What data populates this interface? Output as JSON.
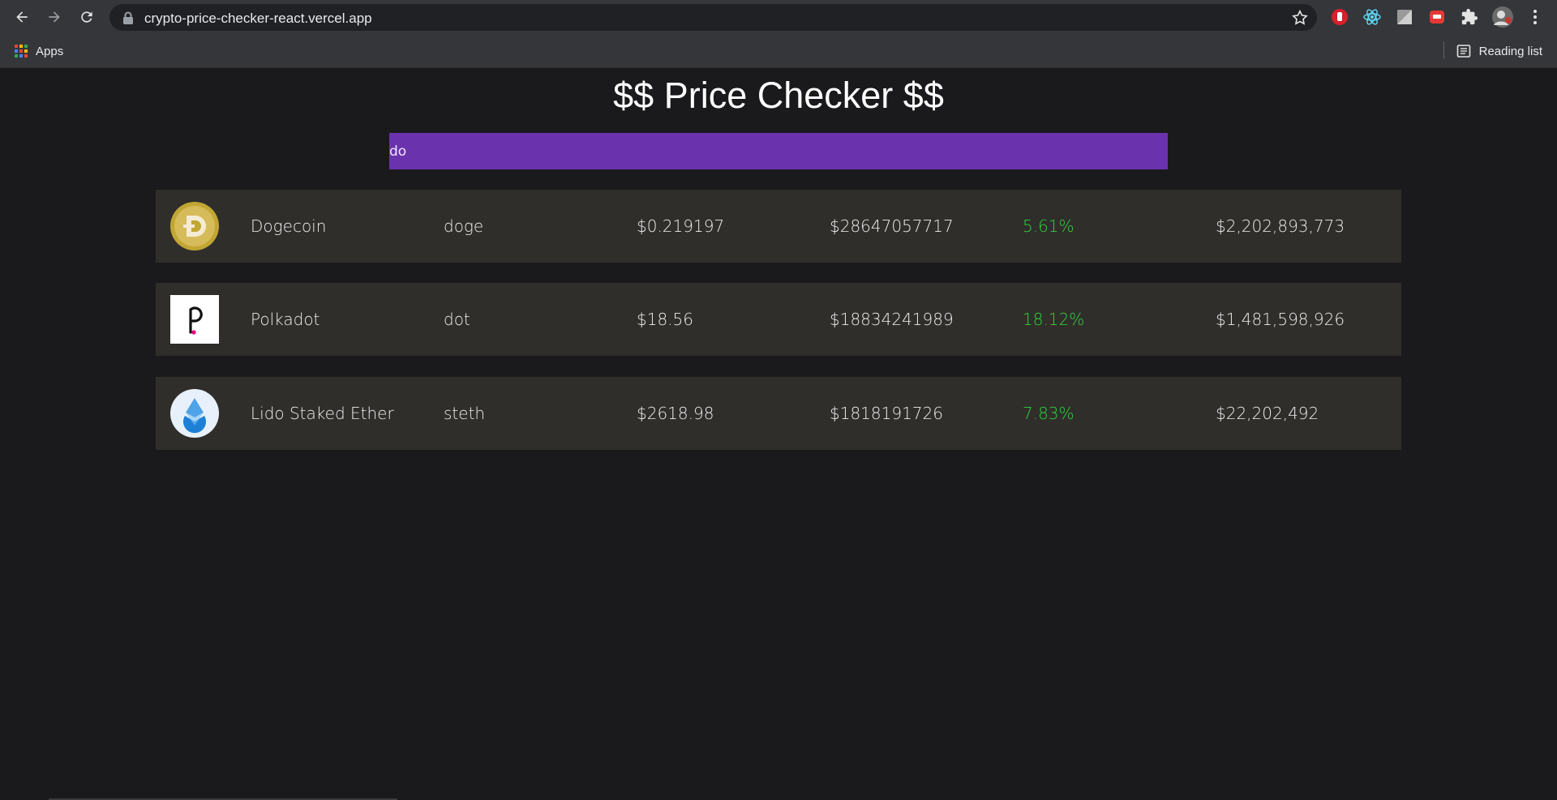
{
  "browser": {
    "url": "crypto-price-checker-react.vercel.app",
    "bookmarks": {
      "apps_label": "Apps",
      "reading_list_label": "Reading list"
    }
  },
  "page": {
    "title": "$$ Price Checker $$",
    "search": {
      "value": "do",
      "placeholder": ""
    }
  },
  "coins": [
    {
      "name": "Dogecoin",
      "symbol": "doge",
      "price": "$0.219197",
      "volume": "$28647057717",
      "change": "5.61%",
      "market_cap": "$2,202,893,773",
      "icon": "dogecoin-logo-icon"
    },
    {
      "name": "Polkadot",
      "symbol": "dot",
      "price": "$18.56",
      "volume": "$18834241989",
      "change": "18.12%",
      "market_cap": "$1,481,598,926",
      "icon": "polkadot-logo-icon"
    },
    {
      "name": "Lido Staked Ether",
      "symbol": "steth",
      "price": "$2618.98",
      "volume": "$1818191726",
      "change": "7.83%",
      "market_cap": "$22,202,492",
      "icon": "lido-logo-icon"
    }
  ],
  "colors": {
    "background": "#1a1a1c",
    "row_background": "#2f2e2b",
    "search_background": "#6a32ac",
    "positive_change": "#2fd43a"
  }
}
